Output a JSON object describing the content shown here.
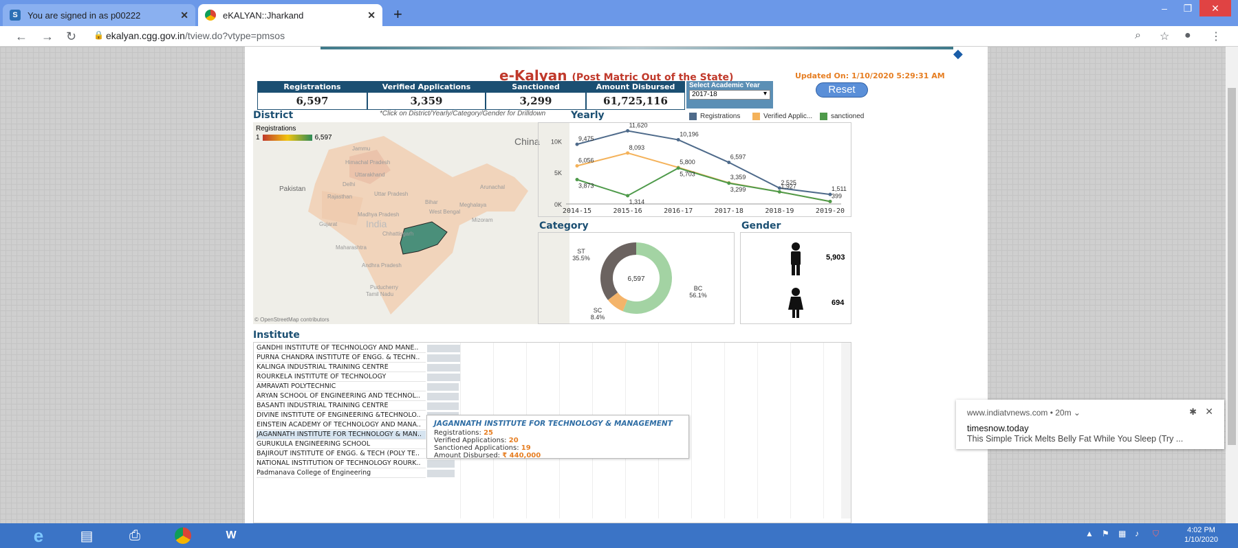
{
  "browser": {
    "tabs": [
      {
        "label": "You are signed in as p00222",
        "favicon": "S"
      },
      {
        "label": "eKALYAN::Jharkand",
        "favicon": "chrome"
      }
    ],
    "url_host": "ekalyan.cgg.gov.in",
    "url_path": "/tview.do?vtype=pmsos"
  },
  "dashboard": {
    "title_main": "e-Kalyan",
    "title_sub": "(Post Matric Out of the State)",
    "updated_label": "Updated On:",
    "updated_value": "1/10/2020 5:29:31 AM",
    "kpis": [
      {
        "label": "Registrations",
        "value": "6,597"
      },
      {
        "label": "Verified Applications",
        "value": "3,359"
      },
      {
        "label": "Sanctioned Applications",
        "value": "3,299"
      },
      {
        "label": "Amount Disbursed",
        "value": "61,725,116"
      }
    ],
    "year_select_label": "Select Academic Year",
    "year_select_value": "2017-18",
    "reset_label": "Reset",
    "district_heading": "District",
    "drill_hint": "*Click on District/Yearly/Category/Gender for Drilldown",
    "map_legend_title": "Registrations",
    "map_legend_min": "1",
    "map_legend_max": "6,597",
    "map_labels": [
      "China",
      "Pakistan",
      "Jammu",
      "Himachal Pradesh",
      "Uttarakhand",
      "Delhi",
      "Rajasthan",
      "Uttar Pradesh",
      "Bihar",
      "Arunachal",
      "Meghalaya",
      "West Bengal",
      "Mizoram",
      "Madhya Pradesh",
      "Gujarat",
      "India",
      "Chhattisgarh",
      "Maharashtra",
      "Andhra Pradesh",
      "Puducherry",
      "Tamil Nadu"
    ],
    "map_credit": "© OpenStreetMap contributors",
    "yearly_heading": "Yearly",
    "category_heading": "Category",
    "gender_heading": "Gender",
    "institute_heading": "Institute"
  },
  "chart_data": [
    {
      "type": "line",
      "title": "Yearly",
      "categories": [
        "2014-15",
        "2015-16",
        "2016-17",
        "2017-18",
        "2018-19",
        "2019-20"
      ],
      "ylim": [
        0,
        12000
      ],
      "y_ticks": [
        "0K",
        "5K",
        "10K"
      ],
      "legend_position": "top-right",
      "series": [
        {
          "name": "Registrations",
          "color": "#4e6a8a",
          "values": [
            9475,
            11620,
            10196,
            6597,
            2525,
            1511
          ]
        },
        {
          "name": "Verified Applic...",
          "color": "#f4b25a",
          "values": [
            6056,
            8093,
            5800,
            3359,
            1927,
            399
          ]
        },
        {
          "name": "sanctioned",
          "color": "#4e9a4a",
          "values": [
            3873,
            1314,
            5703,
            3299,
            1927,
            399
          ]
        }
      ],
      "data_labels": [
        {
          "series": 0,
          "labels": [
            "9,475",
            "11,620",
            "10,196",
            "6,597",
            "2,525",
            "1,511"
          ]
        },
        {
          "series": 1,
          "labels": [
            "6,056",
            "8,093",
            "5,800",
            "3,359",
            "1,927",
            "399"
          ]
        },
        {
          "series": 2,
          "labels": [
            "3,873",
            "1,314",
            "5,703",
            "3,299",
            "",
            ""
          ]
        }
      ]
    },
    {
      "type": "pie",
      "title": "Category",
      "center_label": "6,597",
      "slices": [
        {
          "name": "BC",
          "value": 56.1,
          "label": "56.1%",
          "color": "#a3d3a3"
        },
        {
          "name": "SC",
          "value": 8.4,
          "label": "8.4%",
          "color": "#f4b46a"
        },
        {
          "name": "ST",
          "value": 35.5,
          "label": "35.5%",
          "color": "#6b6360"
        }
      ]
    },
    {
      "type": "bar",
      "title": "Gender",
      "categories": [
        "male",
        "female"
      ],
      "values": [
        5903,
        694
      ],
      "value_labels": [
        "5,903",
        "694"
      ]
    },
    {
      "type": "bar",
      "title": "Institute",
      "categories": [
        "GANDHI INSTITUTE OF TECHNOLOGY AND MANE..",
        "PURNA CHANDRA INSTITUTE OF ENGG. & TECHN..",
        "KALINGA INDUSTRIAL TRAINING CENTRE",
        "ROURKELA INSTITUTE OF TECHNOLOGY",
        "AMRAVATI POLYTECHNIC",
        "ARYAN SCHOOL OF ENGINEERING AND TECHNOL..",
        "BASANTI INDUSTRIAL TRAINING CENTRE",
        "DIVINE INSTITUTE OF ENGINEERING &TECHNOLO..",
        "EINSTEIN ACADEMY OF TECHNOLOGY AND MANA..",
        "JAGANNATH INSTITUTE FOR TECHNOLOGY & MAN..",
        "GURUKULA ENGINEERING SCHOOL",
        "BAJIROUT INSTITUTE OF ENGG. & TECH (POLY TE..",
        "NATIONAL INSTITUTION OF TECHNOLOGY ROURK..",
        "Padmanava College of Engineering"
      ],
      "values": [
        25,
        25,
        25,
        25,
        24,
        24,
        24,
        24,
        24,
        25,
        23,
        22,
        21,
        21
      ],
      "selected_index": 9
    }
  ],
  "tooltip": {
    "title": "JAGANNATH INSTITUTE FOR TECHNOLOGY & MANAGEMENT",
    "rows": [
      {
        "label": "Registrations:",
        "value": "25"
      },
      {
        "label": "Verified Applications:",
        "value": "20"
      },
      {
        "label": "Sanctioned Applications:",
        "value": "19"
      },
      {
        "label": "Amount Disbursed:",
        "value": "₹ 440,000"
      }
    ]
  },
  "notification": {
    "source": "www.indiatvnews.com • 20m ⌄",
    "title": "timesnow.today",
    "body": "This Simple Trick Melts Belly Fat While You Sleep (Try ..."
  },
  "taskbar": {
    "time": "4:02 PM",
    "date": "1/10/2020"
  }
}
